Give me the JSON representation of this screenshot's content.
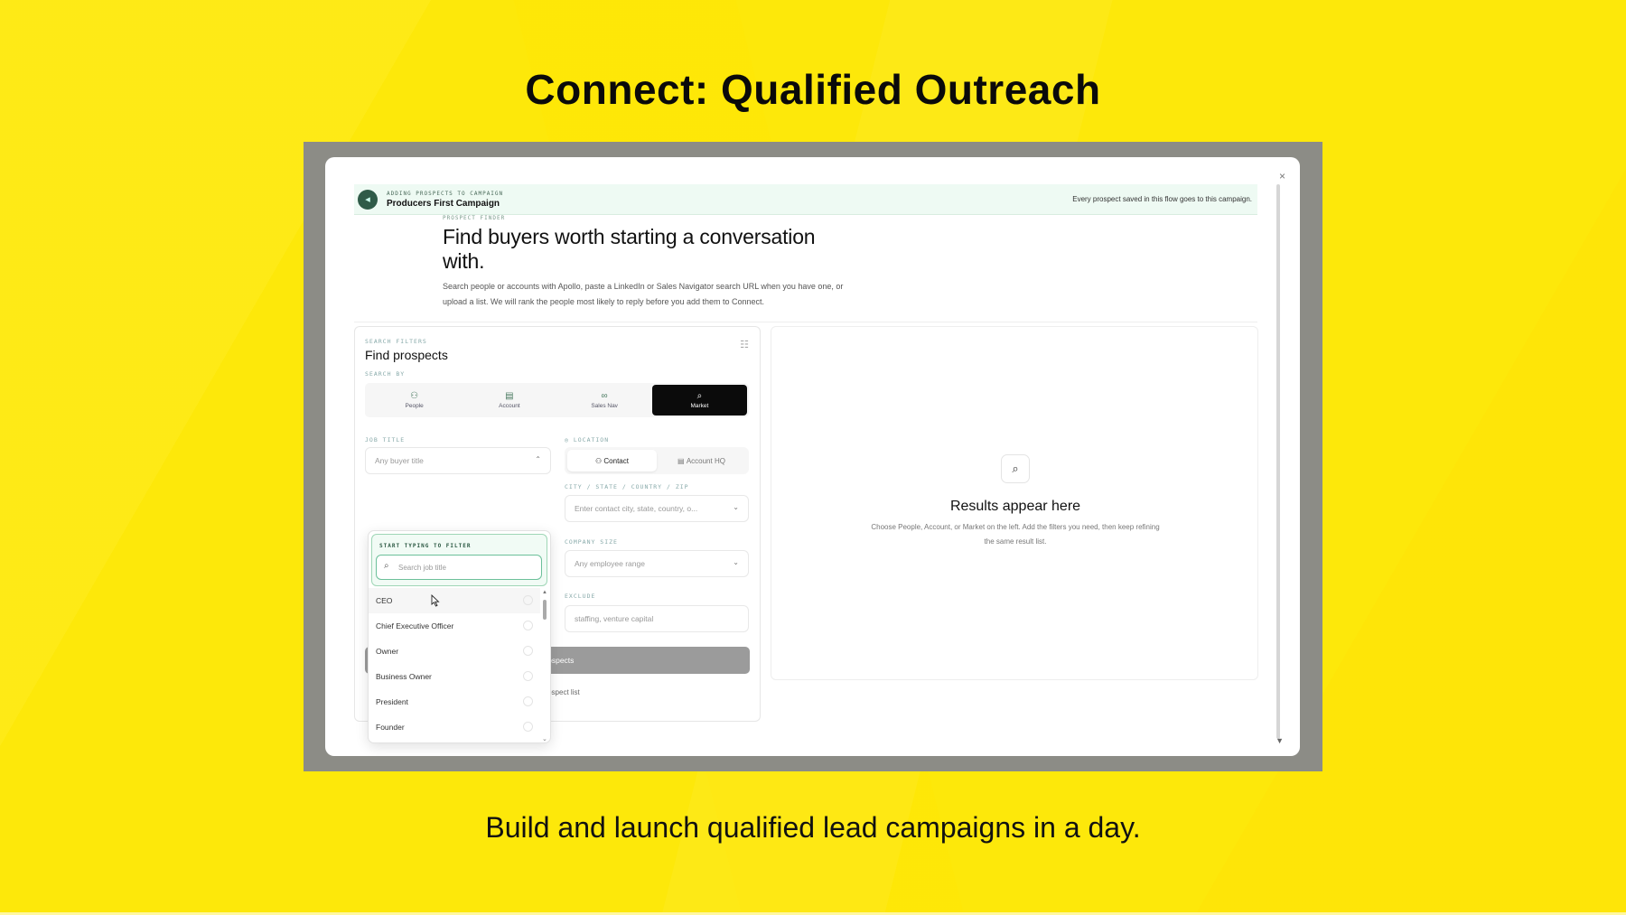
{
  "slide": {
    "title": "Connect: Qualified Outreach",
    "subtitle": "Build and launch qualified lead campaigns in a day."
  },
  "modal": {
    "close": "×",
    "campaign": {
      "kicker": "ADDING PROSPECTS TO CAMPAIGN",
      "name": "Producers First Campaign",
      "note": "Every prospect saved in this flow goes to this campaign."
    },
    "hero": {
      "kicker": "PROSPECT FINDER",
      "title": "Find buyers worth starting a conversation with.",
      "description": "Search people or accounts with Apollo, paste a LinkedIn or Sales Navigator search URL when you have one, or upload a list. We will rank the people most likely to reply before you add them to Connect."
    },
    "filters": {
      "kicker": "SEARCH FILTERS",
      "title": "Find prospects",
      "search_by_label": "SEARCH BY",
      "search_by": [
        {
          "label": "People",
          "icon": "people-icon"
        },
        {
          "label": "Account",
          "icon": "building-icon"
        },
        {
          "label": "Sales Nav",
          "icon": "link-icon"
        },
        {
          "label": "Market",
          "icon": "search-icon",
          "active": true
        }
      ],
      "job_title_label": "JOB TITLE",
      "job_title_placeholder": "Any buyer title",
      "location_label": "LOCATION",
      "location_tabs": [
        "Contact",
        "Account HQ"
      ],
      "city_label": "CITY / STATE / COUNTRY / ZIP",
      "city_placeholder": "Enter contact city, state, country, o...",
      "company_size_label": "COMPANY SIZE",
      "company_size_placeholder": "Any employee range",
      "exclude_label": "EXCLUDE",
      "exclude_placeholder": "staffing, venture capital",
      "search_button": "prospects",
      "upload_link": "a prospect list"
    },
    "dropdown": {
      "kicker": "START TYPING TO FILTER",
      "placeholder": "Search job title",
      "options": [
        "CEO",
        "Chief Executive Officer",
        "Owner",
        "Business Owner",
        "President",
        "Founder"
      ]
    },
    "results": {
      "title": "Results appear here",
      "description": "Choose People, Account, or Market on the left. Add the filters you need, then keep refining the same result list."
    }
  }
}
